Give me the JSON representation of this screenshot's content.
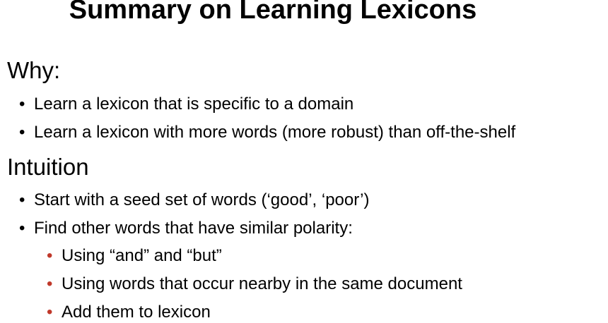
{
  "slide": {
    "title": "Summary on Learning Lexicons",
    "sections": [
      {
        "heading": "Why:",
        "bullets": [
          "Learn a lexicon that is specific to a domain",
          "Learn a lexicon with more words (more robust) than off-the-shelf"
        ]
      },
      {
        "heading": "Intuition",
        "bullets": [
          "Start with a seed set of words (‘good’, ‘poor’)",
          "Find other words that have similar polarity:"
        ],
        "sub_bullets": [
          "Using “and” and “but”",
          "Using words that occur nearby in the same document",
          "Add them to lexicon"
        ]
      }
    ]
  },
  "colors": {
    "text": "#000000",
    "sub_bullet_marker": "#c0392b",
    "background": "#ffffff"
  }
}
